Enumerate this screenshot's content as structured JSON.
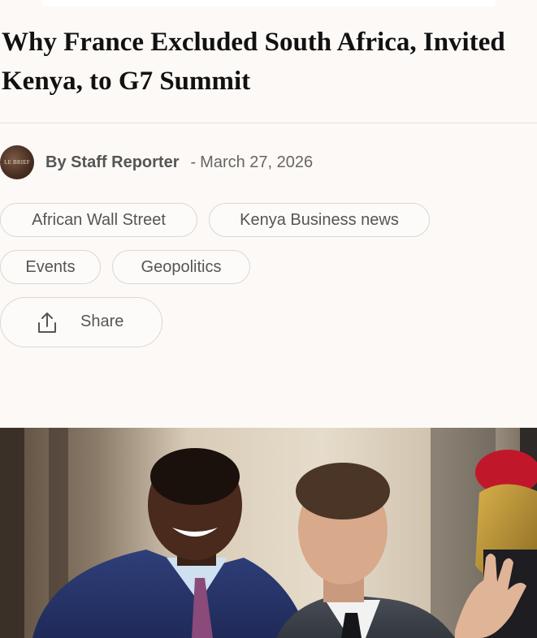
{
  "article": {
    "title": "Why France Excluded South Africa, Invited Kenya, to G7 Summit",
    "author": "By Staff Reporter",
    "date_separator": "-",
    "date": "March 27, 2026",
    "avatar_text": "LE BRIEF",
    "tags": [
      {
        "label": "African Wall Street"
      },
      {
        "label": "Kenya Business news"
      },
      {
        "label": "Events"
      },
      {
        "label": "Geopolitics"
      }
    ],
    "share_label": "Share",
    "hero_image": "photo-of-two-leaders-shaking-hands"
  },
  "colors": {
    "background": "#fcf9f6",
    "headline": "#111111",
    "muted_text": "#555555",
    "border": "#dcd7d2"
  },
  "icons": {
    "share": "share-icon"
  }
}
